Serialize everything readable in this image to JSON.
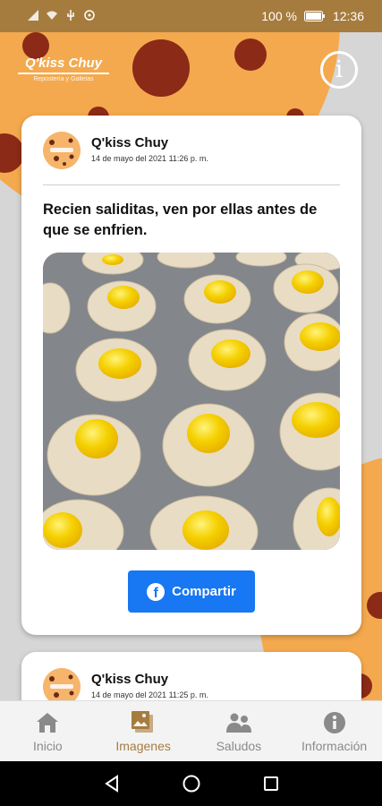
{
  "status_bar": {
    "battery_text": "100 %",
    "time": "12:36"
  },
  "header": {
    "brand_name": "Q'kiss Chuy",
    "brand_tagline": "Repostería y Galletas",
    "info_icon": "info-icon"
  },
  "colors": {
    "accent": "#a67c3e",
    "facebook": "#1877f2",
    "cookie": "#f4a94e",
    "chip": "#8b2a17"
  },
  "posts": [
    {
      "author": "Q'kiss Chuy",
      "date": "14 de mayo del 2021 11:26 p. m.",
      "message": "Recien saliditas, ven por ellas antes de que se enfrien.",
      "share_label": "Compartir"
    },
    {
      "author": "Q'kiss Chuy",
      "date": "14 de mayo del 2021 11:25 p. m."
    }
  ],
  "bottom_nav": {
    "items": [
      {
        "label": "Inicio",
        "icon": "home-icon"
      },
      {
        "label": "Imagenes",
        "icon": "images-icon",
        "active": true
      },
      {
        "label": "Saludos",
        "icon": "people-icon"
      },
      {
        "label": "Información",
        "icon": "info-icon"
      }
    ]
  }
}
